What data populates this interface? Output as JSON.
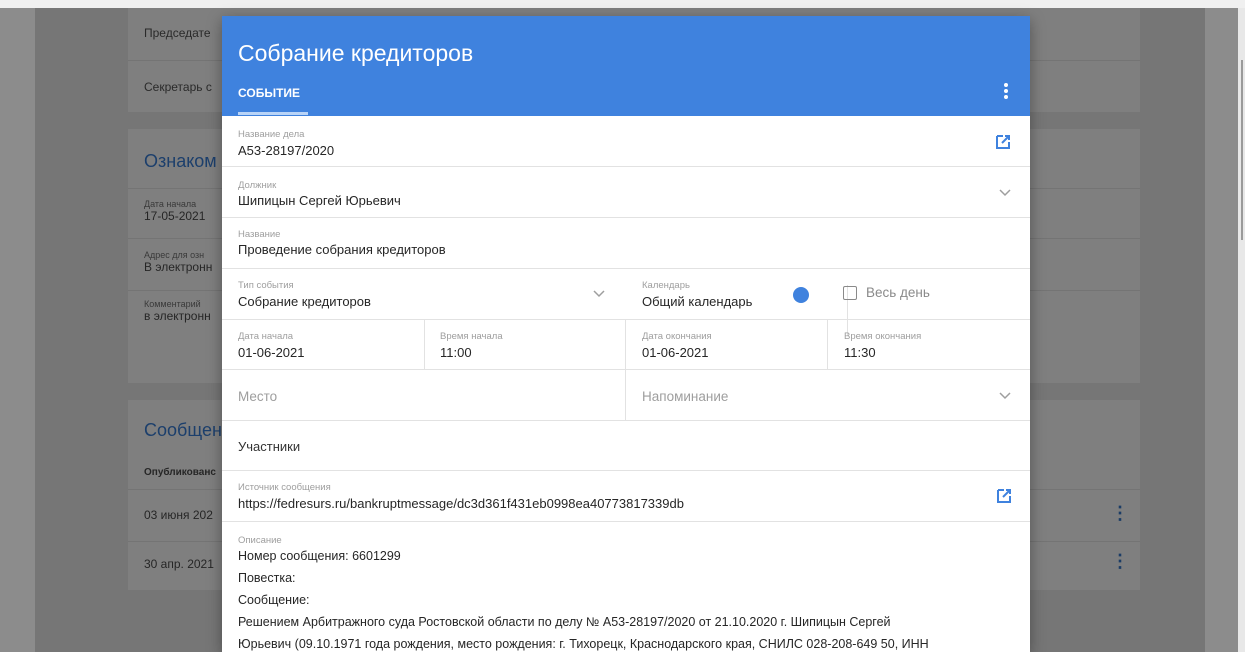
{
  "background": {
    "card1_rows": [
      "Председате",
      "Секретарь с"
    ],
    "card2": {
      "title": "Ознаком",
      "rows": [
        {
          "label": "Дата начала",
          "value": "17-05-2021"
        },
        {
          "label": "Адрес для озн",
          "value": "В электронн"
        },
        {
          "label": "Комментарий",
          "value": "в электронн"
        }
      ]
    },
    "card3": {
      "title": "Сообщен",
      "header": "Опубликованс",
      "rows": [
        "03 июня 202",
        "30 апр. 2021"
      ]
    }
  },
  "dialog": {
    "title": "Собрание кредиторов",
    "tab": "СОБЫТИЕ",
    "case": {
      "label": "Название дела",
      "value": "А53-28197/2020"
    },
    "debtor": {
      "label": "Должник",
      "value": "Шипицын Сергей Юрьевич"
    },
    "name": {
      "label": "Название",
      "value": "Проведение собрания кредиторов"
    },
    "event_type": {
      "label": "Тип события",
      "value": "Собрание кредиторов"
    },
    "calendar": {
      "label": "Календарь",
      "value": "Общий календарь",
      "color": "#3f82de"
    },
    "all_day": {
      "label": "Весь день",
      "checked": false
    },
    "start_date": {
      "label": "Дата начала",
      "value": "01-06-2021"
    },
    "start_time": {
      "label": "Время начала",
      "value": "11:00"
    },
    "end_date": {
      "label": "Дата окончания",
      "value": "01-06-2021"
    },
    "end_time": {
      "label": "Время окончания",
      "value": "11:30"
    },
    "place": {
      "placeholder": "Место"
    },
    "reminder": {
      "placeholder": "Напоминание"
    },
    "participants": {
      "label": "Участники"
    },
    "source": {
      "label": "Источник сообщения",
      "value": "https://fedresurs.ru/bankruptmessage/dc3d361f431eb0998ea40773817339db"
    },
    "description": {
      "label": "Описание",
      "lines": [
        "Номер сообщения: 6601299",
        "Повестка:",
        "Сообщение:",
        "Решением Арбитражного суда Ростовской области по делу № А53-28197/2020 от 21.10.2020 г. Шипицын Сергей",
        "Юрьевич (09.10.1971 года рождения, место рождения: г. Тихорецк, Краснодарского края, СНИЛС 028-208-649 50, ИНН"
      ]
    }
  },
  "colors": {
    "accent": "#3f82de",
    "overlay": "#8c8c8c"
  }
}
